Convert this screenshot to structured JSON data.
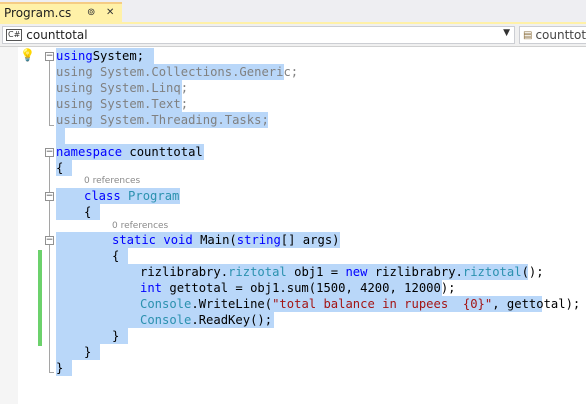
{
  "tab": {
    "title": "Program.cs",
    "pin_icon": "pin-icon",
    "close_icon": "close-icon"
  },
  "navbar": {
    "project_badge": "C#",
    "project_value": "counttotal",
    "member_value": "counttotal"
  },
  "codelens": {
    "class_refs": "0 references",
    "method_refs": "0 references"
  },
  "code_lines": [
    [
      [
        "kw",
        "using"
      ],
      [
        "",
        "System;"
      ]
    ],
    [
      [
        "us",
        "using System.Collections.Generic;"
      ]
    ],
    [
      [
        "us",
        "using System.Linq;"
      ]
    ],
    [
      [
        "us",
        "using System.Text;"
      ]
    ],
    [
      [
        "us",
        "using System.Threading.Tasks;"
      ]
    ],
    [
      [
        "",
        ""
      ]
    ],
    [
      [
        "kw",
        "namespace"
      ],
      [
        "",
        " counttotal"
      ]
    ],
    [
      [
        "",
        "{"
      ]
    ],
    [
      [
        "kw",
        "class"
      ],
      [
        "",
        " "
      ],
      [
        "ty",
        "Program"
      ]
    ],
    [
      [
        "",
        "{"
      ]
    ],
    [
      [
        "kw",
        "static"
      ],
      [
        "",
        " "
      ],
      [
        "kw",
        "void"
      ],
      [
        "",
        " Main("
      ],
      [
        "kw",
        "string"
      ],
      [
        "",
        "[] args)"
      ]
    ],
    [
      [
        "",
        "{"
      ]
    ],
    [
      [
        "",
        "rizlibrabry."
      ],
      [
        "ty",
        "riztotal"
      ],
      [
        "",
        " obj1 = "
      ],
      [
        "kw",
        "new"
      ],
      [
        "",
        " rizlibrabry."
      ],
      [
        "ty",
        "riztotal"
      ],
      [
        "",
        "();"
      ]
    ],
    [
      [
        "kw",
        "int"
      ],
      [
        "",
        " gettotal = obj1.sum(1500, 4200, 12000);"
      ]
    ],
    [
      [
        "ty",
        "Console"
      ],
      [
        "",
        ".WriteLine("
      ],
      [
        "st",
        "\"total balance in rupees  {0}\""
      ],
      [
        "",
        ", gettotal);"
      ]
    ],
    [
      [
        "ty",
        "Console"
      ],
      [
        "",
        ".ReadKey();"
      ]
    ],
    [
      [
        "",
        "}"
      ]
    ],
    [
      [
        "",
        "}"
      ]
    ],
    [
      [
        "",
        "}"
      ]
    ]
  ],
  "colors": {
    "keyword": "#0000ff",
    "type": "#2b91af",
    "string": "#a31515",
    "unused_using": "#808080",
    "selection": "#b9d7f9",
    "tab_active": "#fff1a8",
    "change_bar": "#6cd16c"
  }
}
